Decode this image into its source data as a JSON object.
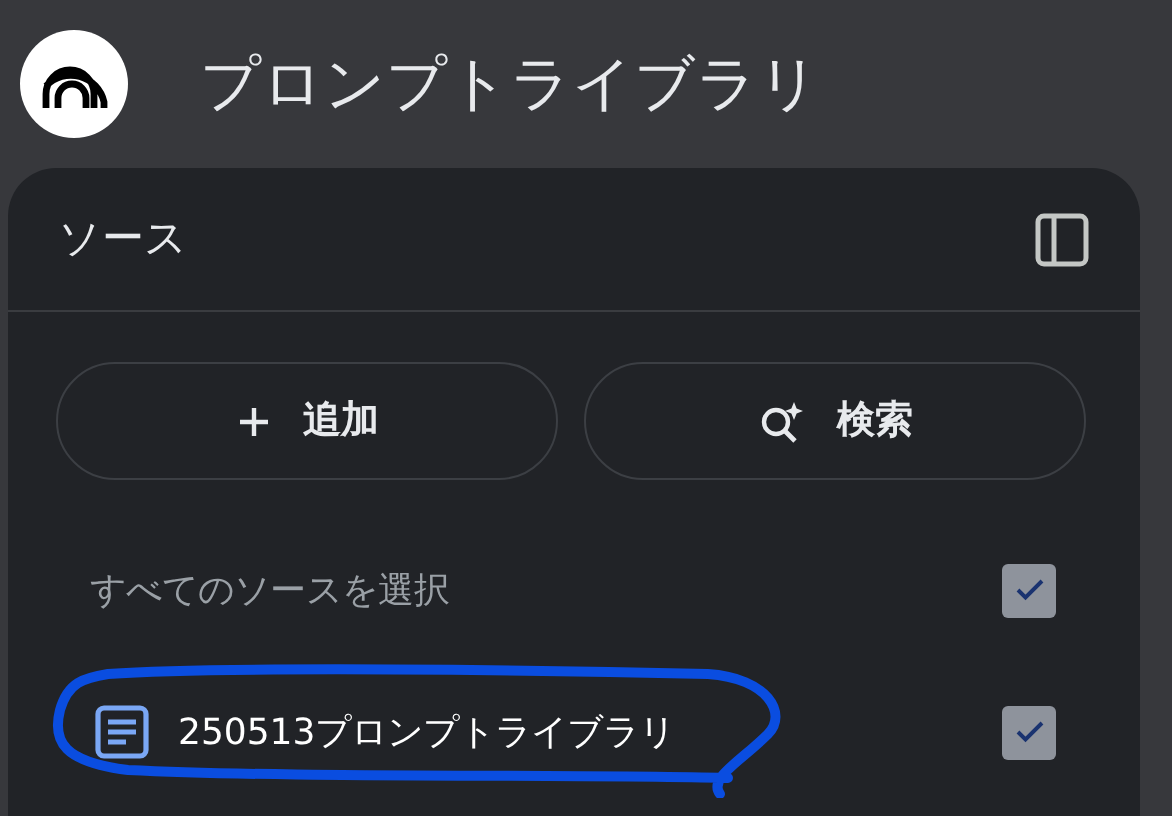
{
  "header": {
    "title": "プロンプトライブラリ"
  },
  "sources_panel": {
    "title": "ソース",
    "buttons": [
      {
        "kind": "add",
        "label": "追加"
      },
      {
        "kind": "search",
        "label": "検索"
      }
    ],
    "select_all": {
      "label": "すべてのソースを選択",
      "checked": true
    },
    "sources": [
      {
        "name": "250513プロンプトライブラリ",
        "checked": true,
        "highlighted": true
      }
    ]
  }
}
